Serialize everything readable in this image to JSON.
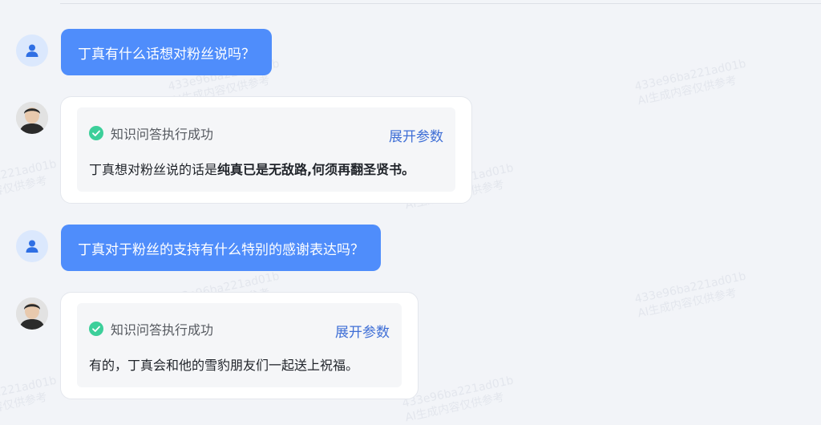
{
  "watermark": {
    "line1": "433e96ba221ad01b",
    "line2": "AI生成内容仅供参考"
  },
  "messages": [
    {
      "role": "user",
      "text": "丁真有什么话想对粉丝说吗？"
    },
    {
      "role": "bot",
      "status": "知识问答执行成功",
      "expand": "展开参数",
      "answer_prefix": "丁真想对粉丝说的话是",
      "answer_bold": "纯真已是无敌路,何须再翻圣贤书。"
    },
    {
      "role": "user",
      "text": "丁真对于粉丝的支持有什么特别的感谢表达吗？"
    },
    {
      "role": "bot",
      "status": "知识问答执行成功",
      "expand": "展开参数",
      "answer": "有的，丁真会和他的雪豹朋友们一起送上祝福。"
    }
  ],
  "colors": {
    "user_bubble": "#4f8dfb",
    "link": "#3f6fd6",
    "success": "#3ccf9a",
    "background": "#f2f4f8"
  },
  "icons": {
    "user_avatar": "person-icon",
    "status": "check-circle-icon"
  }
}
